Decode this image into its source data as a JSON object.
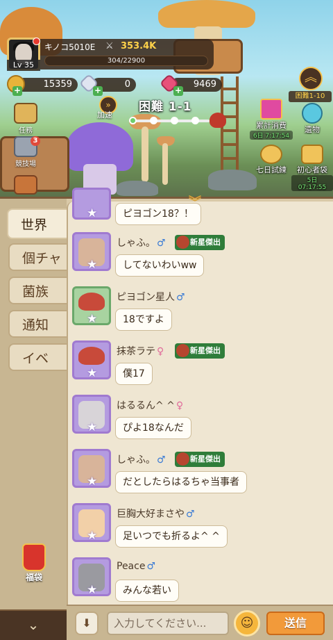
{
  "player": {
    "name": "キノコ5010E",
    "level": "Lv 35",
    "power": "353.4K",
    "xp": "304/22900"
  },
  "currencies": {
    "gold": "15359",
    "crystal": "0",
    "gem": "9469"
  },
  "left_menu": {
    "quests": "任務",
    "arena": "競技場",
    "arena_badge": "3"
  },
  "stage": {
    "speed_label": "加速",
    "title": "困難 1-1",
    "difficulty": "困難1-10"
  },
  "right_menu": {
    "cumulative": "累計消費",
    "cumulative_timer": "6日 7:17:54",
    "relic": "遺物",
    "seven_day": "七日試練",
    "beginner": "初心者袋",
    "beginner_timer": "5日 07:17:55"
  },
  "chat_tabs": [
    "世界",
    "個チャ",
    "菌族",
    "通知",
    "イベ"
  ],
  "fukubukuro": "福袋",
  "badge_label": "新星傑出",
  "messages": [
    {
      "name": "",
      "gender": "",
      "text": "ピヨゴン18？！"
    },
    {
      "name": "しゃふ。",
      "gender": "♂",
      "text": "してないわいww"
    },
    {
      "name": "ピヨゴン星人",
      "gender": "♂",
      "text": "18ですよ"
    },
    {
      "name": "抹茶ラテ",
      "gender": "♀",
      "text": "僕17"
    },
    {
      "name": "はるるん^ ^",
      "gender": "♀",
      "text": "ぴよ18なんだ"
    },
    {
      "name": "しゃふ。",
      "gender": "♂",
      "text": "だとしたらはるちゃ当事者"
    },
    {
      "name": "巨胸大好まさや",
      "gender": "♂",
      "text": "足いつでも折るよ^ ^"
    },
    {
      "name": "Peace",
      "gender": "♂",
      "text": "みんな若い"
    }
  ],
  "input": {
    "placeholder": "入力してください..."
  },
  "send_label": "送信",
  "colors": {
    "accent_gold": "#f5c04a",
    "send": "#f29a3a",
    "badge_green": "#2f7d3a"
  }
}
